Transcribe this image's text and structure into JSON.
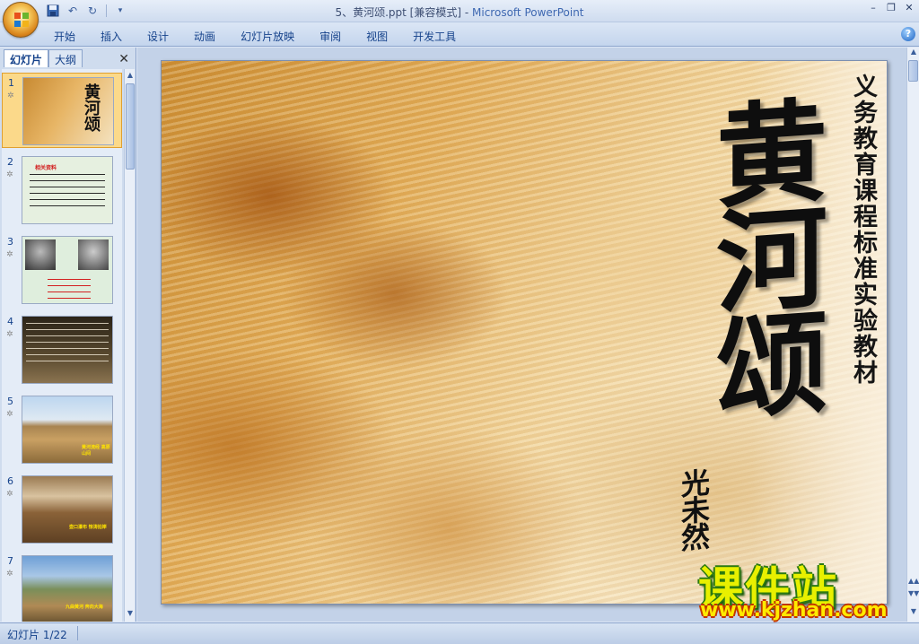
{
  "window": {
    "doc_title": "5、黄河颂.ppt [兼容模式]",
    "separator": " - ",
    "app_name": "Microsoft PowerPoint"
  },
  "quick_access": {
    "save_icon": "save-icon",
    "undo_icon": "undo-icon",
    "redo_icon": "redo-icon",
    "customize_icon": "chevron-down-icon"
  },
  "ribbon": {
    "tabs": [
      "开始",
      "插入",
      "设计",
      "动画",
      "幻灯片放映",
      "审阅",
      "视图",
      "开发工具"
    ],
    "help": "?"
  },
  "panel": {
    "tab_slides": "幻灯片",
    "tab_outline": "大纲",
    "close": "✕",
    "slides": [
      {
        "num": "1"
      },
      {
        "num": "2"
      },
      {
        "num": "3"
      },
      {
        "num": "4"
      },
      {
        "num": "5"
      },
      {
        "num": "6"
      },
      {
        "num": "7"
      }
    ],
    "slide_labels": {
      "s1_title": "黄河颂",
      "s2_heading": "相关资料",
      "s5_caption": "黄河流经 高原山间",
      "s6_caption": "壶口瀑布 惊涛拍岸",
      "s7_caption": "九曲黄河 奔向大海"
    }
  },
  "slide": {
    "subtitle": "义务教育课程标准实验教材",
    "title": "黄河颂",
    "author": "光未然"
  },
  "watermark": {
    "name": "课件站",
    "url": "www.kjzhan.com"
  },
  "status": {
    "slide_counter": "幻灯片 1/22"
  },
  "colors": {
    "ribbon_text": "#15428b",
    "selected_thumb": "#fbd98a",
    "watermark_fill": "#e8f000",
    "watermark_stroke": "#2c7a11"
  }
}
